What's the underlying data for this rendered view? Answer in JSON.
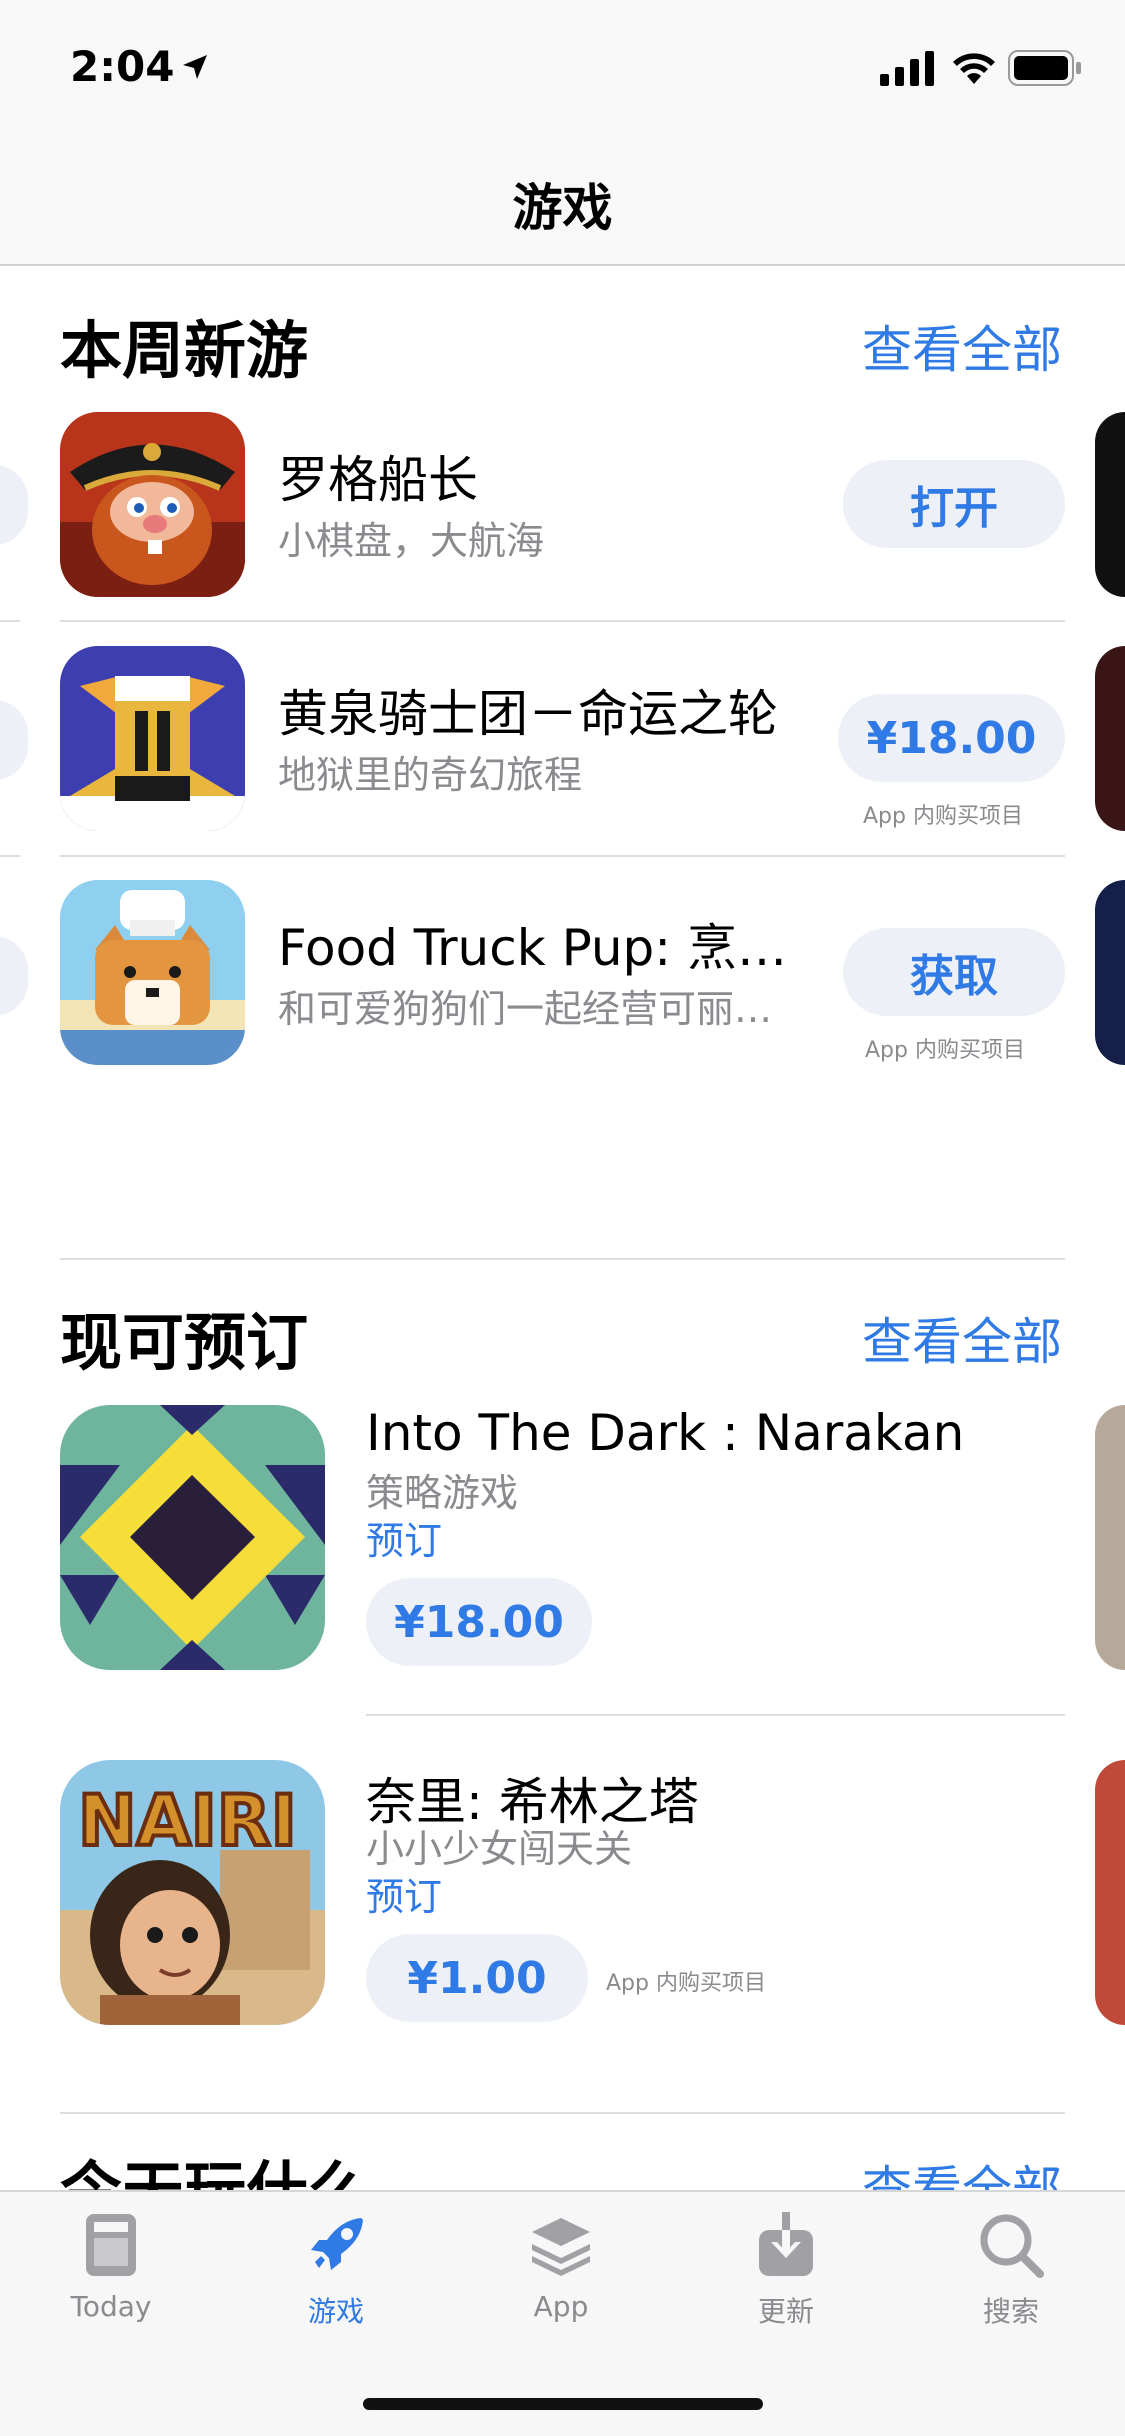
{
  "status_bar": {
    "time": "2:04"
  },
  "nav": {
    "title": "游戏"
  },
  "section_new": {
    "title": "本周新游",
    "see_all": "查看全部",
    "apps": [
      {
        "name": "罗格船长",
        "subtitle": "小棋盘，大航海",
        "action": "打开",
        "iap": ""
      },
      {
        "name": "黄泉骑士团－命运之轮",
        "subtitle": "地狱里的奇幻旅程",
        "action": "¥18.00",
        "iap": "App 内购买项目"
      },
      {
        "name": "Food Truck Pup: 烹…",
        "subtitle": "和可爱狗狗们一起经营可丽…",
        "action": "获取",
        "iap": "App 内购买项目"
      }
    ]
  },
  "section_preorder": {
    "title": "现可预订",
    "see_all": "查看全部",
    "apps": [
      {
        "name": "Into The Dark : Narakan",
        "subtitle": "策略游戏",
        "tag": "预订",
        "price": "¥18.00",
        "iap": ""
      },
      {
        "name": "奈里: 希林之塔",
        "subtitle": "小小少女闯天关",
        "tag": "预订",
        "price": "¥1.00",
        "iap": "App 内购买项目"
      }
    ]
  },
  "section_next": {
    "title": "今天玩什么",
    "see_all": "查看全部"
  },
  "tabbar": {
    "tabs": [
      {
        "label": "Today",
        "icon": "today-icon",
        "active": false
      },
      {
        "label": "游戏",
        "icon": "rocket-icon",
        "active": true
      },
      {
        "label": "App",
        "icon": "stack-icon",
        "active": false
      },
      {
        "label": "更新",
        "icon": "download-icon",
        "active": false
      },
      {
        "label": "搜索",
        "icon": "search-icon",
        "active": false
      }
    ]
  },
  "colors": {
    "accent": "#2f7ae5",
    "pill_bg": "#eef0f7",
    "gray_text": "#8a8a8f"
  },
  "icon_art": {
    "logo_text": "NAIRI"
  }
}
